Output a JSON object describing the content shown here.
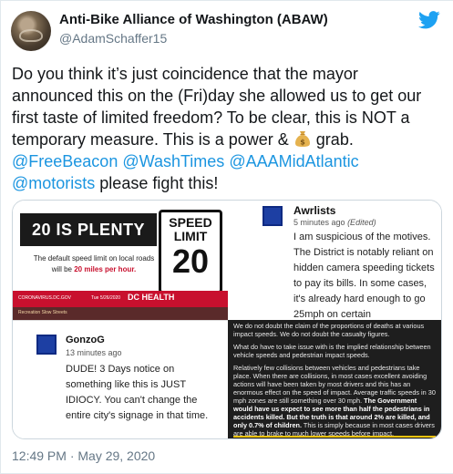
{
  "author": {
    "name": "Anti-Bike Alliance of Washington (ABAW)",
    "handle": "@AdamSchaffer15"
  },
  "tweet": {
    "text_1": "Do you think it’s just coincidence that the mayor announced this on the (Fri)day she allowed us to get our first taste of limited freedom? To be clear, this is NOT a temporary measure. This is a power & ",
    "text_2": " grab.",
    "mention_1": "@FreeBeacon",
    "mention_2": "@WashTimes",
    "mention_3": "@AAAMidAtlantic",
    "mention_4": "@motorists",
    "text_3": " please fight this!",
    "timestamp": "12:49 PM · May 29, 2020"
  },
  "media": {
    "dc_graphic": {
      "headline": "20 IS PLENTY",
      "sign_line_1": "SPEED",
      "sign_line_2": "LIMIT",
      "sign_number": "20",
      "subtext": "The default speed limit on local roads",
      "subtext_2": "will be ",
      "subtext_highlight": "20 miles per hour.",
      "url": "CORONAVIRUS.DC.GOV",
      "date": "Tue 5/26/2020",
      "agency": "DC HEALTH",
      "bottom_label": "Recreation Slow Streets"
    },
    "comment_awrlists": {
      "name": "Awrlists",
      "time": "5 minutes ago",
      "edited": "(Edited)",
      "text": "I am suspicious of the motives. The District is notably reliant on hidden camera speeding tickets to pay its bills. In some cases, it's already hard enough to go 25mph on certain"
    },
    "comment_gonzog": {
      "name": "GonzoG",
      "time": "13 minutes ago",
      "text": "DUDE! 3 Days notice on something like this is JUST IDIOCY. You can't change the entire city's signage in that time."
    },
    "article": {
      "p1": "We do not doubt the claim of the proportions of deaths at various impact speeds. We do not doubt the casualty figures.",
      "p2": "What do have to take issue with is the implied relationship between vehicle speeds and pedestrian impact speeds.",
      "p3": "Relatively few collisions between vehicles and pedestrians take place. When there are collisions, in most cases excellent avoiding actions will have been taken by most drivers and this has an enormous effect on the speed of impact. Average traffic speeds in 30 mph zones are still something over 30 mph. ",
      "p3_bold": "The Government would have us expect to see more than half the pedestrians in accidents killed. But the truth is that around 2% are killed, and only 0.7% of children.",
      "p3_end": " This is simply because in most cases drivers are able to brake to much lower speeds before impact."
    }
  },
  "icons": [
    "twitter-bird-icon",
    "money-bag-icon"
  ],
  "colors": {
    "link": "#1b95e0",
    "twitter_blue": "#1da1f2",
    "dc_red": "#c8102e"
  }
}
